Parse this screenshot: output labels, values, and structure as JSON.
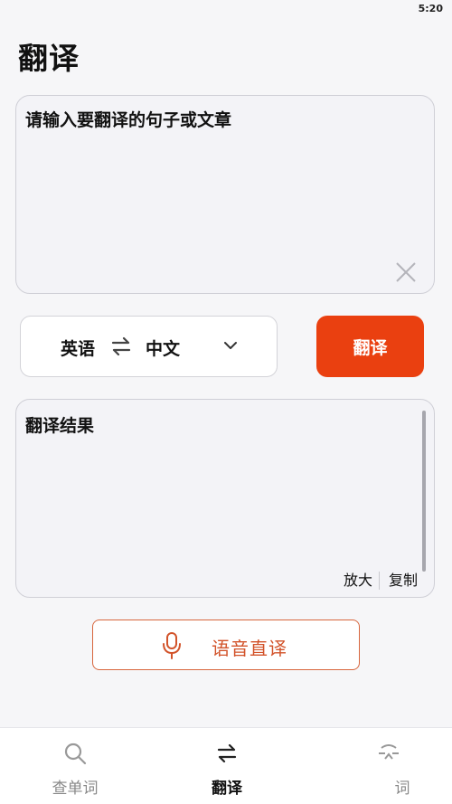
{
  "status_bar": {
    "time": "5:20"
  },
  "page": {
    "title": "翻译"
  },
  "input": {
    "placeholder": "请输入要翻译的句子或文章"
  },
  "language": {
    "source": "英语",
    "target": "中文"
  },
  "translate_button": {
    "label": "翻译"
  },
  "result": {
    "placeholder": "翻译结果",
    "zoom_label": "放大",
    "copy_label": "复制"
  },
  "voice_button": {
    "label": "语音直译"
  },
  "tabs": [
    {
      "label": "查单词",
      "icon": "search-icon",
      "active": false
    },
    {
      "label": "翻译",
      "icon": "swap-arrows-icon",
      "active": true
    },
    {
      "label": "词",
      "icon": "camera-scan-icon",
      "active": false
    }
  ],
  "colors": {
    "accent": "#ea4010",
    "voice_accent": "#d2532a",
    "background": "#f6f6f8"
  }
}
